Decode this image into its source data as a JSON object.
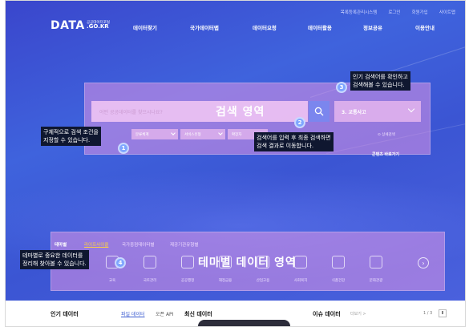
{
  "util_links": [
    "목록등록관리시스템",
    "로그인",
    "회원가입",
    "사이트맵"
  ],
  "logo": {
    "main": "DATA",
    "sub1": "공공데이터포털",
    "sub2": ".GO.KR"
  },
  "gnb": [
    {
      "label": "데이터찾기"
    },
    {
      "label": "국가데이터맵"
    },
    {
      "label": "데이터요청"
    },
    {
      "label": "데이터활용"
    },
    {
      "label": "정보공유"
    },
    {
      "label": "이용안내"
    }
  ],
  "search": {
    "placeholder": "어떤 공공데이터를 찾으시나요?",
    "zone_label": "검색 영역",
    "popular_selected": "3. 교통사고",
    "filters": [
      "분류체계",
      "서비스유형",
      "확장자"
    ],
    "detail_search": "상세검색",
    "content_jump": "콘텐츠 바로가기"
  },
  "annotations": [
    {
      "num": "1",
      "text_lines": [
        "구체적으로 검색 조건을",
        "지정할 수 있습니다."
      ]
    },
    {
      "num": "2",
      "text_lines": [
        "검색어를 입력 후 최종 검색하면",
        "검색 결과로 이동합니다."
      ]
    },
    {
      "num": "3",
      "text_lines": [
        "인기 검색어를 확인하고",
        "검색해볼 수 있습니다."
      ]
    },
    {
      "num": "4",
      "text_lines": [
        "테마별로 중요한 데이터를",
        "정리해 찾아볼 수 있습니다."
      ]
    }
  ],
  "theme": {
    "tabs": [
      "테마별",
      "라이프사이클",
      "국가중점데이터별",
      "제공기관유형별"
    ],
    "zone_label": "테마별 데이터 영역",
    "items": [
      "교육",
      "국토관리",
      "공공행정",
      "재정금융",
      "산업고용",
      "사회복지",
      "식품건강",
      "문화관광"
    ],
    "next_symbol": "›"
  },
  "bottom": {
    "popular": "인기 데이터",
    "file_data": "파일 데이터",
    "open_api": "오픈 API",
    "latest": "최신 데이터",
    "issue": "이슈 데이터",
    "issue_more": "더보기 >",
    "pager": "1 / 3"
  },
  "colors": {
    "hero": "#3f5cd9",
    "zone": "#de96e6",
    "annotation_bg": "#0f1730",
    "badge": "#7fa6ff",
    "active_tab": "#ffd23f"
  }
}
